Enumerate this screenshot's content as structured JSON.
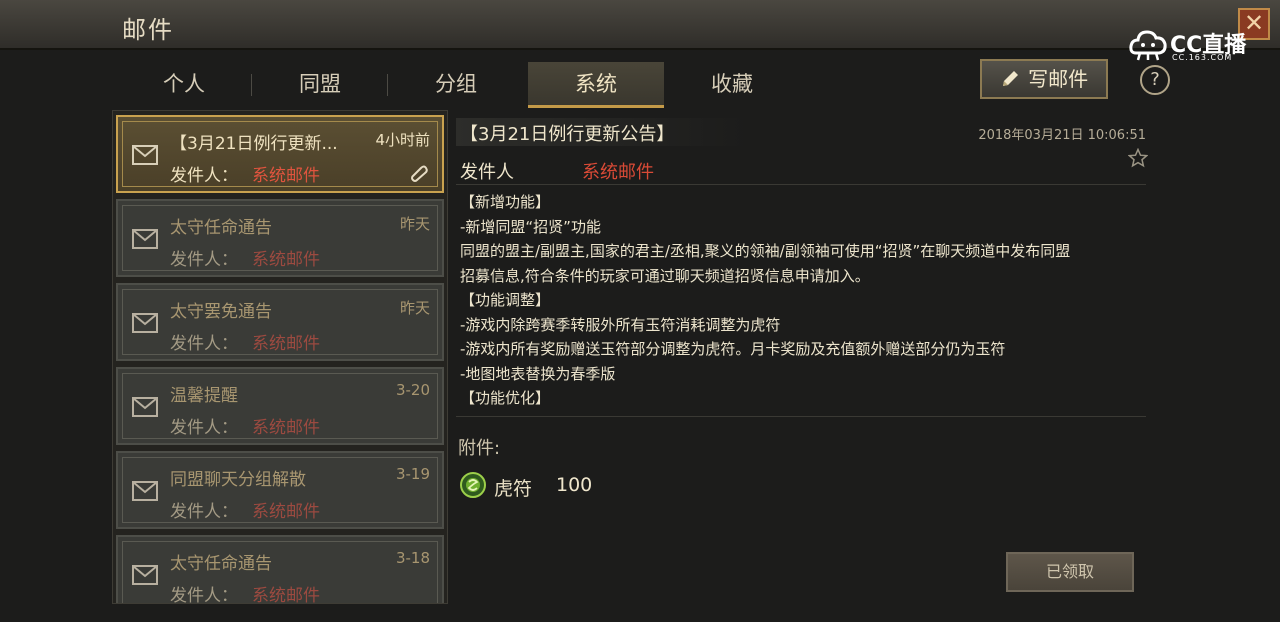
{
  "window": {
    "title": "邮件",
    "close_glyph": "✕"
  },
  "watermark": {
    "brand": "CC直播",
    "url": "CC.163.COM"
  },
  "tabs": [
    {
      "label": "个人",
      "active": false
    },
    {
      "label": "同盟",
      "active": false
    },
    {
      "label": "分组",
      "active": false
    },
    {
      "label": "系统",
      "active": true
    },
    {
      "label": "收藏",
      "active": false
    }
  ],
  "toolbar": {
    "write_label": "写邮件",
    "help_glyph": "?"
  },
  "mail_list": [
    {
      "subject": "【3月21日例行更新...",
      "time": "4小时前",
      "sender_label": "发件人：",
      "sender": "系统邮件",
      "selected": true,
      "has_attachment": true
    },
    {
      "subject": "太守任命通告",
      "time": "昨天",
      "sender_label": "发件人：",
      "sender": "系统邮件",
      "selected": false,
      "has_attachment": false
    },
    {
      "subject": "太守罢免通告",
      "time": "昨天",
      "sender_label": "发件人：",
      "sender": "系统邮件",
      "selected": false,
      "has_attachment": false
    },
    {
      "subject": "温馨提醒",
      "time": "3-20",
      "sender_label": "发件人：",
      "sender": "系统邮件",
      "selected": false,
      "has_attachment": false
    },
    {
      "subject": "同盟聊天分组解散",
      "time": "3-19",
      "sender_label": "发件人：",
      "sender": "系统邮件",
      "selected": false,
      "has_attachment": false
    },
    {
      "subject": "太守任命通告",
      "time": "3-18",
      "sender_label": "发件人：",
      "sender": "系统邮件",
      "selected": false,
      "has_attachment": false
    }
  ],
  "detail": {
    "title": "【3月21日例行更新公告】",
    "date": "2018年03月21日 10:06:51",
    "sender_label": "发件人",
    "sender": "系统邮件",
    "content_lines": [
      "【新增功能】",
      "-新增同盟“招贤”功能",
      " 同盟的盟主/副盟主,国家的君主/丞相,聚义的领袖/副领袖可使用“招贤”在聊天频道中发布同盟",
      "招募信息,符合条件的玩家可通过聊天频道招贤信息申请加入。",
      "【功能调整】",
      "-游戏内除跨赛季转服外所有玉符消耗调整为虎符",
      "-游戏内所有奖励赠送玉符部分调整为虎符。月卡奖励及充值额外赠送部分仍为玉符",
      "-地图地表替换为春季版",
      "【功能优化】"
    ],
    "attachment_label": "附件:",
    "attachment": {
      "name": "虎符",
      "quantity": "100",
      "icon": "tiger-tally-icon"
    },
    "claimed_label": "已领取"
  },
  "colors": {
    "accent_gold": "#c9a24f",
    "sender_red": "#d94a36"
  }
}
